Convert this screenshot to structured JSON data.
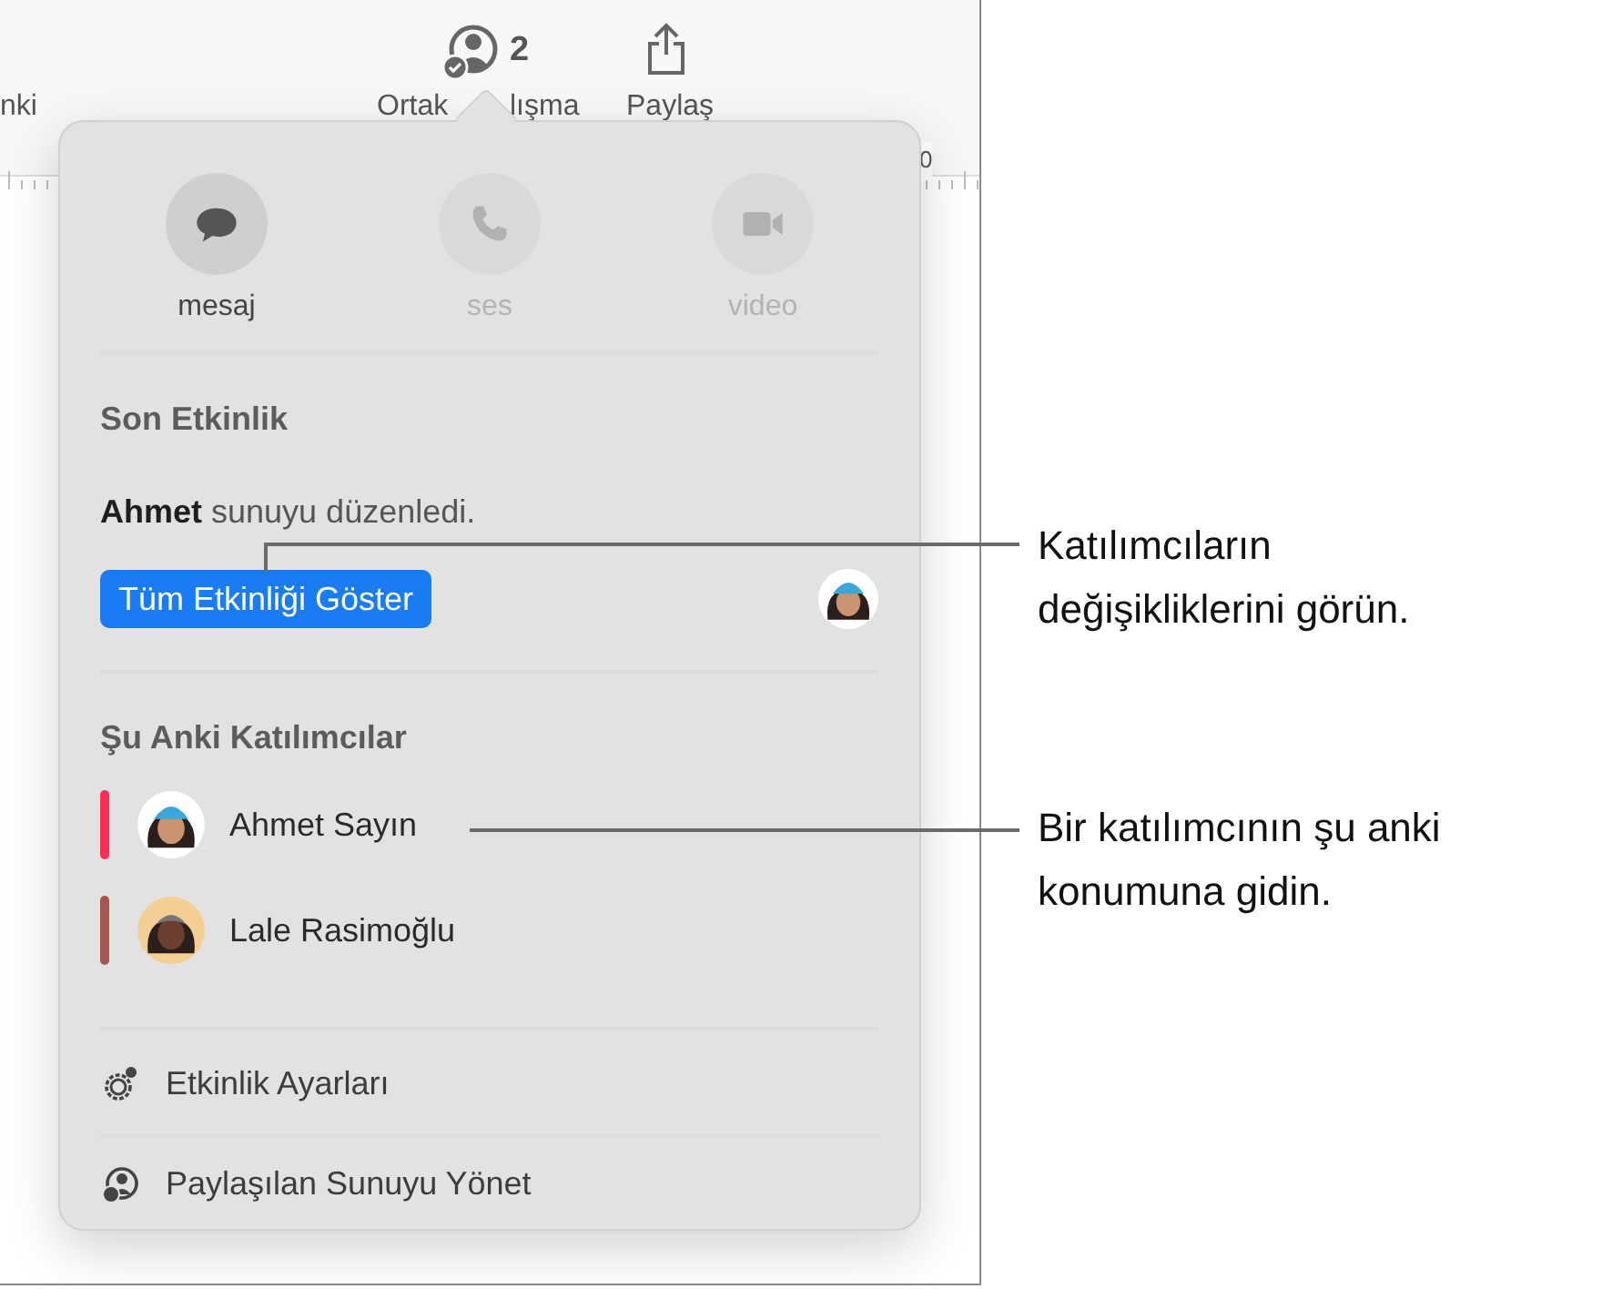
{
  "toolbar": {
    "partial_label": "nki",
    "collaborate": {
      "count": "2",
      "label_parts": [
        "Ortak",
        "lışma"
      ]
    },
    "share": {
      "label": "Paylaş"
    },
    "ruler_label": "0"
  },
  "popover": {
    "contact_buttons": [
      {
        "kind": "message",
        "label": "mesaj",
        "disabled": false
      },
      {
        "kind": "phone",
        "label": "ses",
        "disabled": true
      },
      {
        "kind": "video",
        "label": "video",
        "disabled": true
      }
    ],
    "activity": {
      "heading": "Son Etkinlik",
      "entry": "**Ahmet** sunuyu düzenledi.",
      "button": "Tüm Etkinliği Göster"
    },
    "participants": {
      "heading": "Şu Anki Katılımcılar",
      "items": [
        {
          "name": "Ahmet Sayın",
          "color": "#ff2d55",
          "kind": "capped"
        },
        {
          "name": "Lale Rasimoğlu",
          "color": "#a5574c",
          "kind": "curly"
        }
      ]
    },
    "menu": [
      {
        "kind": "settings",
        "label": "Etkinlik Ayarları"
      },
      {
        "kind": "manage",
        "label": "Paylaşılan Sunuyu Yönet"
      }
    ]
  },
  "callouts": [
    {
      "lines": [
        "Katılımcıların",
        "değişikliklerini görün."
      ]
    },
    {
      "lines": [
        "Bir katılımcının şu anki",
        "konumuna gidin."
      ]
    }
  ]
}
